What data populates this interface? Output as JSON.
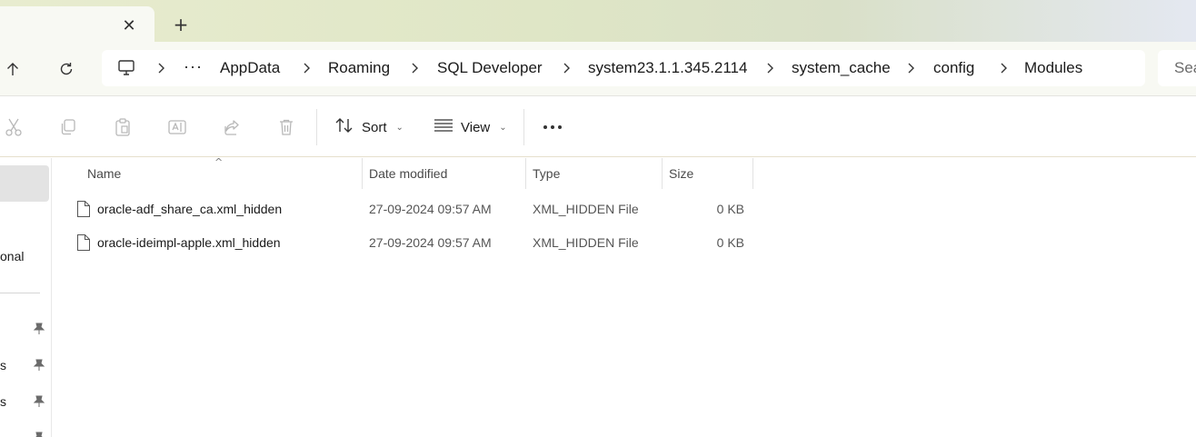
{
  "window": {
    "tab_close_glyph": "✕",
    "new_tab_glyph": "+"
  },
  "nav": {
    "up_icon": "arrow-up-icon",
    "refresh_icon": "refresh-icon"
  },
  "address": {
    "root_icon": "this-pc-icon",
    "overflow_label": "···",
    "crumbs": [
      "AppData",
      "Roaming",
      "SQL Developer",
      "system23.1.1.345.2114",
      "system_cache",
      "config",
      "Modules"
    ]
  },
  "search": {
    "placeholder": "Sea"
  },
  "commands": {
    "cut_icon": "scissors-icon",
    "copy_icon": "copy-icon",
    "paste_icon": "paste-icon",
    "rename_icon": "rename-icon",
    "share_icon": "share-icon",
    "delete_icon": "trash-icon",
    "sort_label": "Sort",
    "view_label": "View",
    "more_label": "···"
  },
  "navpane": {
    "partial_label": "onal",
    "pinned_partial": [
      "s",
      "s"
    ]
  },
  "columns": {
    "name": "Name",
    "date": "Date modified",
    "type": "Type",
    "size": "Size",
    "sort_indicator": "^"
  },
  "files": [
    {
      "name": "oracle-adf_share_ca.xml_hidden",
      "date": "27-09-2024 09:57 AM",
      "type": "XML_HIDDEN File",
      "size": "0 KB"
    },
    {
      "name": "oracle-ideimpl-apple.xml_hidden",
      "date": "27-09-2024 09:57 AM",
      "type": "XML_HIDDEN File",
      "size": "0 KB"
    }
  ],
  "colors": {
    "accent": "#0067c0",
    "selection": "#e3e3e3",
    "disabled_icon": "#b8b8b8"
  }
}
